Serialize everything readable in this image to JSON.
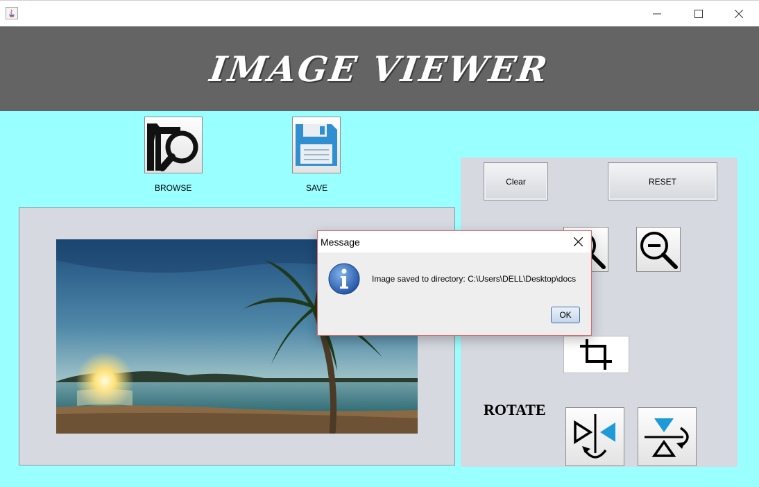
{
  "window": {
    "icon": "java-icon",
    "controls": [
      "minimize-icon",
      "maximize-icon",
      "close-icon"
    ]
  },
  "header": {
    "title": "IMAGE VIEWER"
  },
  "toolbar": {
    "browse_label": "BROWSE",
    "browse_icon": "folder-search-icon",
    "save_label": "SAVE",
    "save_icon": "floppy-disk-icon"
  },
  "controls": {
    "clear_label": "Clear",
    "reset_label": "RESET",
    "zoom_in_icon": "zoom-in-icon",
    "zoom_out_icon": "zoom-out-icon",
    "crop_icon": "crop-icon",
    "rotate_label": "ROTATE",
    "flip_horizontal_icon": "flip-horizontal-icon",
    "flip_vertical_icon": "flip-vertical-icon"
  },
  "dialog": {
    "title": "Message",
    "icon": "info-icon",
    "message": "Image saved to directory: C:\\Users\\DELL\\Desktop\\docs",
    "ok_label": "OK"
  },
  "colors": {
    "background": "#99ffff",
    "header": "#646464",
    "panel": "#d6d9e0",
    "dialog_border": "#d86a6a"
  }
}
